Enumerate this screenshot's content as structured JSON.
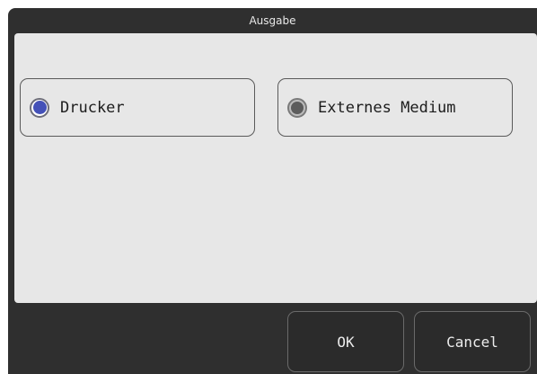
{
  "dialog": {
    "title": "Ausgabe"
  },
  "options": [
    {
      "label": "Drucker",
      "selected": true,
      "icon": "radio-selected-icon"
    },
    {
      "label": "Externes Medium",
      "selected": false,
      "icon": "radio-unselected-icon"
    }
  ],
  "buttons": {
    "ok_label": "OK",
    "cancel_label": "Cancel"
  },
  "colors": {
    "window_background": "#2f2f2f",
    "panel_background": "#e7e7e7",
    "radio_selected_fill": "#4451b8"
  }
}
